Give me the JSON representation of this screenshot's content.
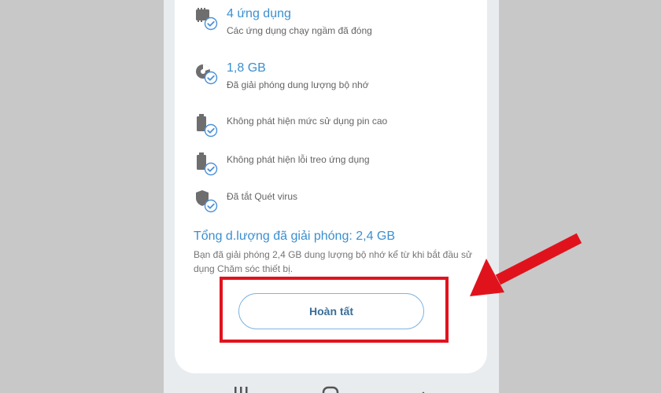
{
  "items": [
    {
      "title": "4 ứng dụng",
      "subtitle": "Các ứng dụng chạy ngầm đã đóng",
      "icon": "memory-chip-check-icon"
    },
    {
      "title": "1,8 GB",
      "subtitle": "Đã giải phóng dung lượng bộ nhớ",
      "icon": "storage-pie-check-icon"
    },
    {
      "text": "Không phát hiện mức sử dụng pin cao",
      "icon": "battery-check-icon"
    },
    {
      "text": "Không phát hiện lỗi treo ứng dụng",
      "icon": "battery-check-icon"
    },
    {
      "text": "Đã tắt Quét virus",
      "icon": "shield-check-icon"
    }
  ],
  "summary": {
    "title": "Tổng d.lượng đã giải phóng: 2,4 GB",
    "description": "Bạn đã giải phóng 2,4 GB dung lượng bộ nhớ kể từ khi bắt đầu sử dụng Chăm sóc thiết bị."
  },
  "done_button": {
    "label": "Hoàn tất"
  },
  "colors": {
    "accent": "#3b8fd0",
    "highlight": "#e0131d",
    "check_badge": "#4a90d9"
  }
}
